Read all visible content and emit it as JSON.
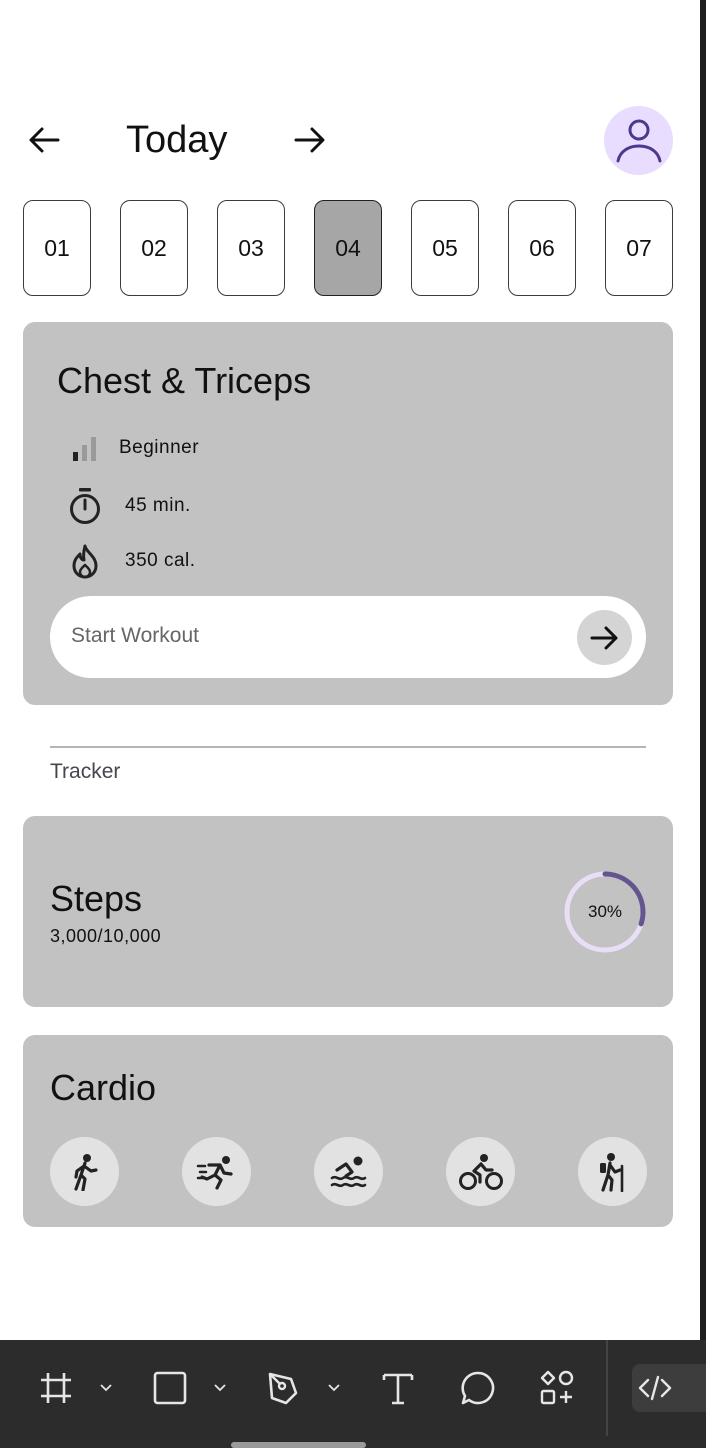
{
  "header": {
    "title": "Today",
    "prev_icon": "arrow-left-icon",
    "next_icon": "arrow-right-icon",
    "avatar_icon": "person-icon"
  },
  "days": {
    "items": [
      "01",
      "02",
      "03",
      "04",
      "05",
      "06",
      "07"
    ],
    "selected": "04"
  },
  "workout": {
    "title": "Chest & Triceps",
    "level": "Beginner",
    "duration": "45 min.",
    "calories": "350 cal.",
    "start_label": "Start Workout"
  },
  "tracker": {
    "section_label": "Tracker",
    "steps_title": "Steps",
    "steps_count": "3,000/10,000",
    "steps_percent_label": "30%",
    "steps_progress": 0.3
  },
  "cardio": {
    "title": "Cardio",
    "activities": [
      "walking-icon",
      "running-icon",
      "swimming-icon",
      "cycling-icon",
      "hiking-icon"
    ]
  },
  "toolbar": {
    "tools": [
      "frame-icon",
      "rectangle-icon",
      "pen-icon",
      "text-icon",
      "comment-icon",
      "components-icon",
      "code-icon"
    ]
  },
  "colors": {
    "card_bg": "#c2c2c2",
    "selected_day": "#a6a6a6",
    "accent": "#65558f",
    "avatar_bg": "#e9ddff",
    "ring_track": "#e8def8",
    "toolbar_bg": "#2c2c2c"
  }
}
